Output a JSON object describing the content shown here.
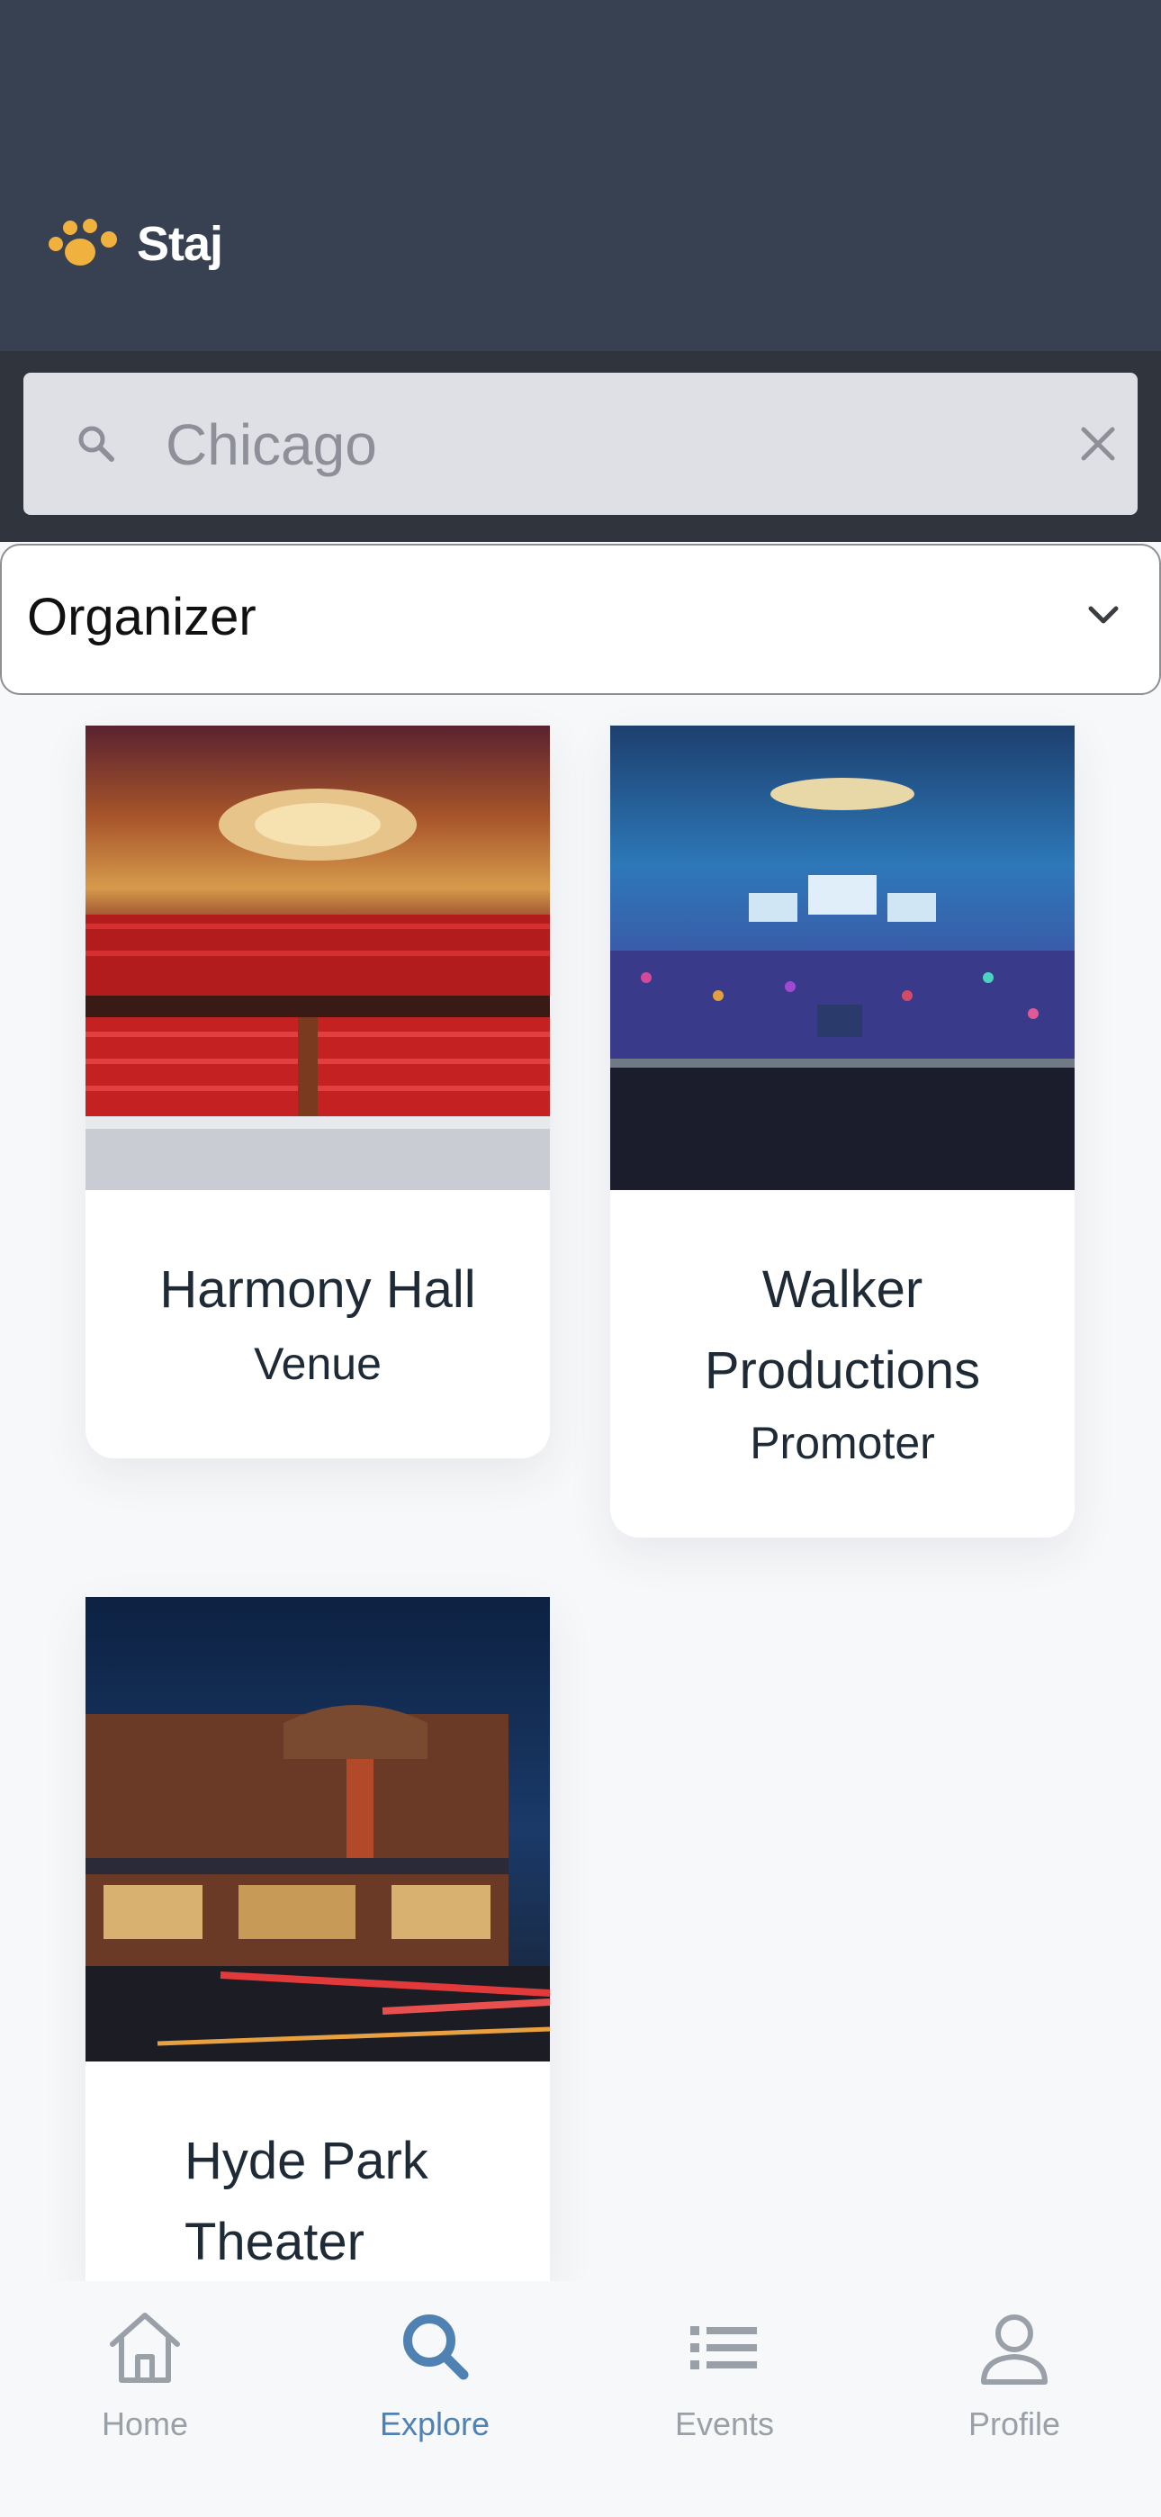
{
  "header": {
    "brand": "Staj",
    "brand_color": "#f0b13e",
    "logo_icon": "paw-dots-icon"
  },
  "search": {
    "placeholder": "Chicago",
    "value": "",
    "search_icon": "search-icon",
    "clear_icon": "close-icon"
  },
  "filter": {
    "selected": "Organizer",
    "icon": "chevron-down-icon"
  },
  "organizers": [
    {
      "name": "Harmony Hall",
      "type": "Venue",
      "image": "theater-interior-photo"
    },
    {
      "name": "Walker Productions",
      "type": "Promoter",
      "image": "conference-crowd-photo"
    },
    {
      "name": "Hyde Park Theater",
      "type": "",
      "image": "theater-exterior-night-photo"
    }
  ],
  "tabbar": {
    "tabs": [
      {
        "label": "Home",
        "icon": "home-icon",
        "active": false
      },
      {
        "label": "Explore",
        "icon": "search-icon",
        "active": true
      },
      {
        "label": "Events",
        "icon": "list-icon",
        "active": false
      },
      {
        "label": "Profile",
        "icon": "user-icon",
        "active": false
      }
    ],
    "active_color": "#4f82b3",
    "inactive_color": "#9aa0a8"
  }
}
